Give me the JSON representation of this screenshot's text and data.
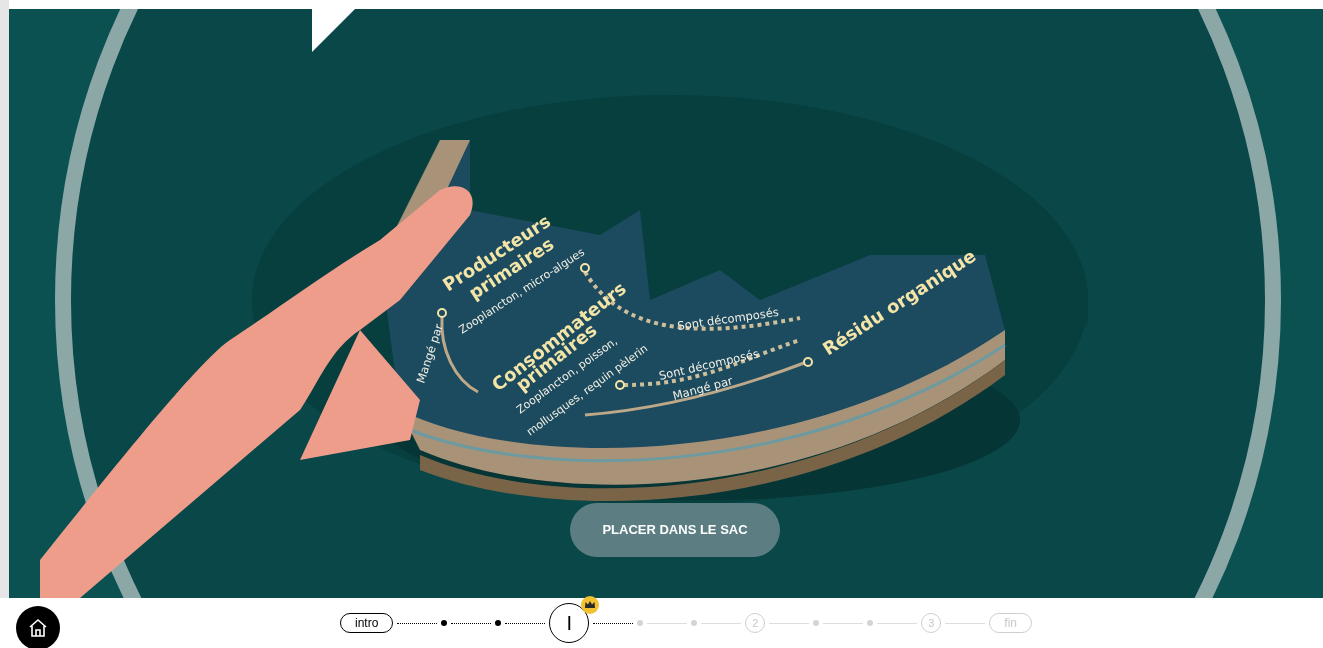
{
  "stage": {
    "labels": [
      {
        "kind": "heading",
        "text": "Producteurs"
      },
      {
        "kind": "heading",
        "text": "primaires"
      },
      {
        "kind": "caption",
        "text": "Zooplancton, micro-algues"
      },
      {
        "kind": "arrow",
        "text": "Mangé par"
      },
      {
        "kind": "heading",
        "text": "Consommateurs"
      },
      {
        "kind": "heading",
        "text": "primaires"
      },
      {
        "kind": "caption",
        "text": "Zooplancton, poisson,"
      },
      {
        "kind": "caption",
        "text": "mollusques, requin pèlerin"
      },
      {
        "kind": "arrow",
        "text": "Sont décomposés"
      },
      {
        "kind": "arrow",
        "text": "Sont décomposés"
      },
      {
        "kind": "arrow",
        "text": "Mangé par"
      },
      {
        "kind": "heading",
        "text": "Résidu organique"
      }
    ],
    "button": "PLACER DANS LE SAC"
  },
  "nav": {
    "steps": [
      {
        "kind": "pill",
        "label": "intro",
        "done": true,
        "selected": false
      },
      {
        "kind": "dot",
        "done": true,
        "selected": false
      },
      {
        "kind": "dot",
        "done": true,
        "selected": false
      },
      {
        "kind": "chapter",
        "label": "I",
        "done": true,
        "selected": true
      },
      {
        "kind": "dot",
        "done": false,
        "selected": false
      },
      {
        "kind": "dot",
        "done": false,
        "selected": false
      },
      {
        "kind": "chapter",
        "label": "2",
        "done": false,
        "selected": false
      },
      {
        "kind": "dot",
        "done": false,
        "selected": false
      },
      {
        "kind": "dot",
        "done": false,
        "selected": false
      },
      {
        "kind": "chapter",
        "label": "3",
        "done": false,
        "selected": false
      },
      {
        "kind": "pill",
        "label": "fin",
        "done": false,
        "selected": false
      }
    ]
  }
}
